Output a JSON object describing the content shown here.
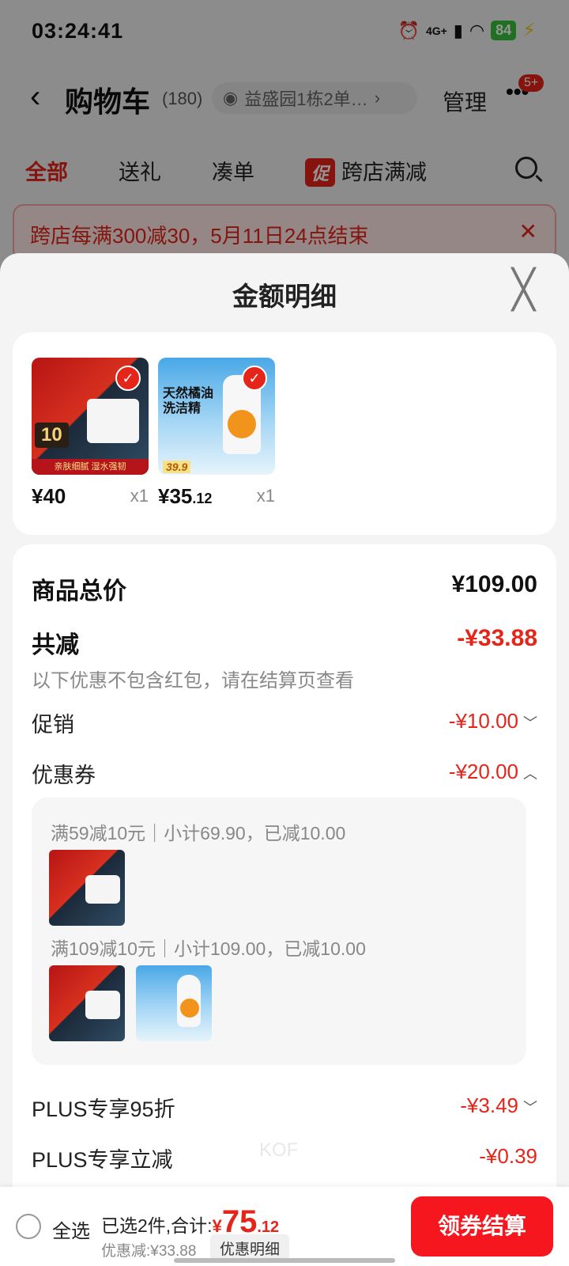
{
  "status": {
    "time": "03:24:41",
    "network": "4G+",
    "battery": "84"
  },
  "nav": {
    "title": "购物车",
    "count": "(180)",
    "address": "益盛园1栋2单…",
    "manage": "管理",
    "badge": "5+"
  },
  "tabs": [
    {
      "label": "全部"
    },
    {
      "label": "送礼"
    },
    {
      "label": "凑单"
    },
    {
      "label": "跨店满减",
      "promo": "促"
    }
  ],
  "banner": {
    "text": "跨店每满300减30，5月11日24点结束"
  },
  "sheet": {
    "title": "金额明细",
    "products": [
      {
        "price_int": "¥40",
        "price_dec": "",
        "qty": "x1",
        "label": "10",
        "subtitle": "亲肤细腻 湿水强韧"
      },
      {
        "price_int": "¥35",
        "price_dec": ".12",
        "qty": "x1",
        "title": "天然橘油洗洁精",
        "tag": "39.9"
      }
    ],
    "total_label": "商品总价",
    "total_value": "¥109.00",
    "reduce_label": "共减",
    "reduce_value": "-¥33.88",
    "reduce_note": "以下优惠不包含红包，请在结算页查看",
    "promo_label": "促销",
    "promo_value": "-¥10.00",
    "coupon_label": "优惠券",
    "coupon_value": "-¥20.00",
    "coupon_lines": [
      "满59减10元｜小计69.90，已减10.00",
      "满109减10元｜小计109.00，已减10.00"
    ],
    "plus95_label": "PLUS专享95折",
    "plus95_value": "-¥3.49",
    "plus_label": "PLUS专享立减",
    "plus_value": "-¥0.39",
    "watermark": "KOF"
  },
  "bottom": {
    "select_all": "全选",
    "selected": "已选2件,合计:",
    "currency": "¥",
    "total_int": "75",
    "total_dec": ".12",
    "discount": "优惠减:¥33.88",
    "detail": "优惠明细",
    "checkout": "领券结算"
  }
}
